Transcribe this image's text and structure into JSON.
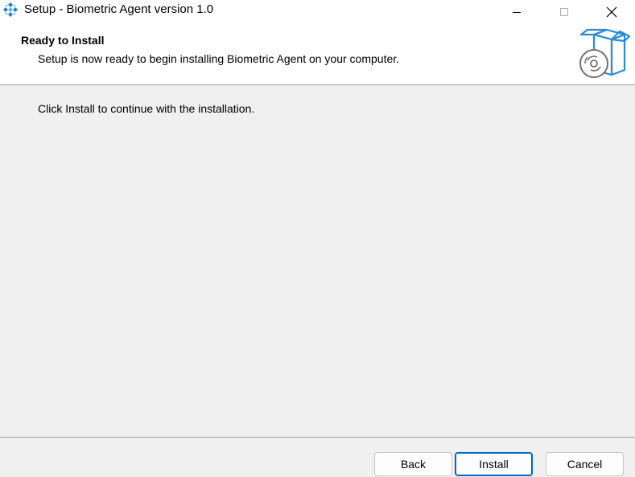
{
  "window": {
    "title": "Setup - Biometric Agent version 1.0"
  },
  "header": {
    "title": "Ready to Install",
    "subtitle": "Setup is now ready to begin installing Biometric Agent on your computer."
  },
  "main": {
    "instruction": "Click Install to continue with the installation."
  },
  "footer": {
    "back_label": "Back",
    "install_label": "Install",
    "cancel_label": "Cancel"
  },
  "colors": {
    "accent": "#0067c0",
    "icon_blue": "#2a8bd6"
  }
}
